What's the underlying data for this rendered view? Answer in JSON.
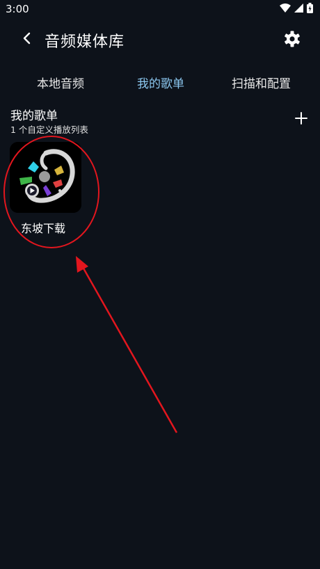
{
  "status_bar": {
    "time": "3:00",
    "icons": [
      "wifi-icon",
      "cell-signal-icon",
      "battery-charging-icon"
    ]
  },
  "app_bar": {
    "title": "音频媒体库",
    "back_icon": "chevron-left-icon",
    "settings_icon": "gear-icon"
  },
  "tabs": [
    {
      "label": "本地音频",
      "active": false
    },
    {
      "label": "我的歌单",
      "active": true
    },
    {
      "label": "扫描和配置",
      "active": false
    }
  ],
  "section": {
    "title": "我的歌单",
    "subtitle": "1 个自定义播放列表",
    "add_icon": "plus-icon"
  },
  "playlists": [
    {
      "name": "东坡下载",
      "cover_icon": "app-logo-icon"
    }
  ],
  "colors": {
    "background": "#0d121a",
    "text": "#ffffff",
    "tab_active": "#8cc8f0",
    "annotation": "#e3161e"
  }
}
